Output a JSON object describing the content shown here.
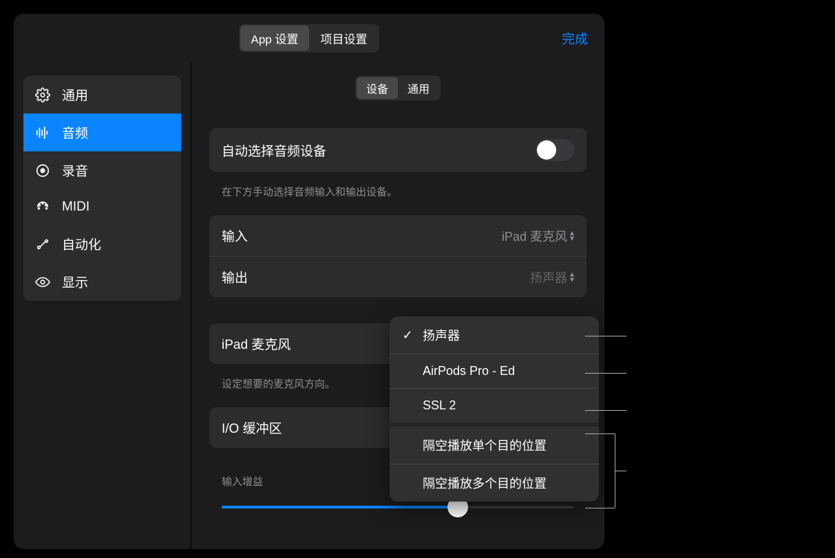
{
  "header": {
    "tab_app": "App 设置",
    "tab_project": "项目设置",
    "done": "完成"
  },
  "sidebar": {
    "items": [
      {
        "icon": "gear",
        "label": "通用"
      },
      {
        "icon": "waveform",
        "label": "音频"
      },
      {
        "icon": "record",
        "label": "录音"
      },
      {
        "icon": "midi",
        "label": "MIDI"
      },
      {
        "icon": "automation",
        "label": "自动化"
      },
      {
        "icon": "eye",
        "label": "显示"
      }
    ]
  },
  "subtabs": {
    "device": "设备",
    "general": "通用"
  },
  "auto_select": {
    "label": "自动选择音频设备",
    "enabled": false,
    "caption": "在下方手动选择音频输入和输出设备。"
  },
  "io": {
    "input_label": "输入",
    "input_value": "iPad 麦克风",
    "output_label": "输出",
    "output_value": "扬声器"
  },
  "mic": {
    "label": "iPad 麦克风",
    "caption": "设定想要的麦克风方向。"
  },
  "buffer": {
    "label": "I/O 缓冲区"
  },
  "gain": {
    "label": "输入增益",
    "value_pct": 67
  },
  "dropdown": {
    "items": [
      {
        "label": "扬声器",
        "checked": true
      },
      {
        "label": "AirPods Pro - Ed",
        "checked": false
      },
      {
        "label": "SSL 2",
        "checked": false
      },
      {
        "label": "隔空播放单个目的位置",
        "checked": false,
        "sep": true
      },
      {
        "label": "隔空播放多个目的位置",
        "checked": false
      }
    ]
  }
}
